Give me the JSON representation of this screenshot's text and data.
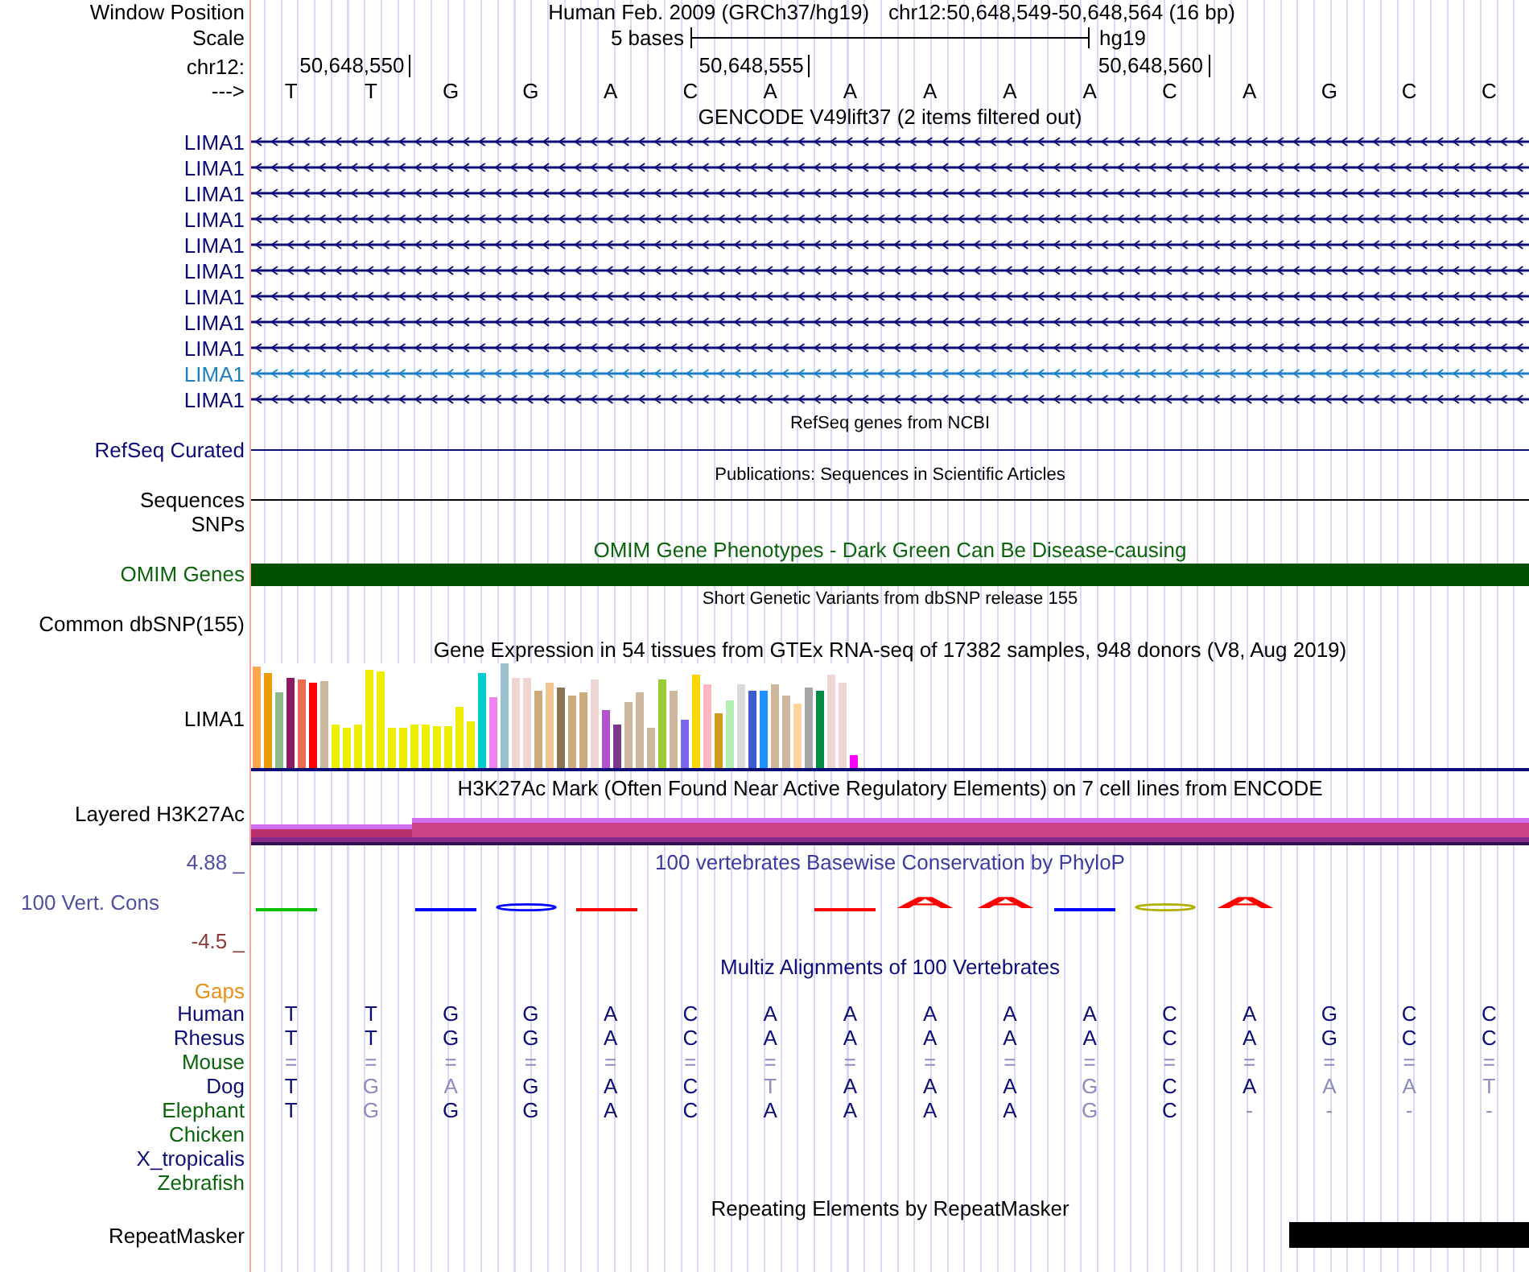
{
  "position": {
    "label": "Window Position",
    "assembly": "Human Feb. 2009 (GRCh37/hg19)",
    "range": "chr12:50,648,549-50,648,564 (16 bp)"
  },
  "scale": {
    "label": "Scale",
    "span": "5 bases",
    "assembly": "hg19"
  },
  "ruler": {
    "label": "chr12:",
    "ticks": [
      "50,648,550",
      "50,648,555",
      "50,648,560"
    ]
  },
  "sequence": {
    "label": "--->",
    "bases": [
      "T",
      "T",
      "G",
      "G",
      "A",
      "C",
      "A",
      "A",
      "A",
      "A",
      "A",
      "C",
      "A",
      "G",
      "C",
      "C"
    ]
  },
  "gencode": {
    "title": "GENCODE V49lift37 (2 items filtered out)",
    "transcripts": [
      {
        "name": "LIMA1",
        "color": "#0c0c78"
      },
      {
        "name": "LIMA1",
        "color": "#0c0c78"
      },
      {
        "name": "LIMA1",
        "color": "#0c0c78"
      },
      {
        "name": "LIMA1",
        "color": "#0c0c78"
      },
      {
        "name": "LIMA1",
        "color": "#0c0c78"
      },
      {
        "name": "LIMA1",
        "color": "#0c0c78"
      },
      {
        "name": "LIMA1",
        "color": "#0c0c78"
      },
      {
        "name": "LIMA1",
        "color": "#0c0c78"
      },
      {
        "name": "LIMA1",
        "color": "#0c0c78"
      },
      {
        "name": "LIMA1",
        "color": "#1f7fc4"
      },
      {
        "name": "LIMA1",
        "color": "#0c0c78"
      }
    ]
  },
  "refseq": {
    "title": "RefSeq genes from NCBI",
    "label": "RefSeq Curated"
  },
  "publications": {
    "title": "Publications: Sequences in Scientific Articles",
    "label": "Sequences"
  },
  "snps": {
    "label": "SNPs"
  },
  "omim": {
    "title": "OMIM Gene Phenotypes - Dark Green Can Be Disease-causing",
    "label": "OMIM Genes"
  },
  "dbsnp": {
    "title": "Short Genetic Variants from dbSNP release 155",
    "label": "Common dbSNP(155)"
  },
  "gtex": {
    "title": "Gene Expression in 54 tissues from GTEx RNA-seq of 17382 samples, 948 donors (V8, Aug 2019)",
    "label": "LIMA1",
    "bars": [
      {
        "color": "#ffa54f"
      },
      {
        "color": "#ee9a00"
      },
      {
        "color": "#8fbc8f"
      },
      {
        "color": "#8b1c62"
      },
      {
        "color": "#ee6a50"
      },
      {
        "color": "#ff0000"
      },
      {
        "color": "#cdb79e"
      },
      {
        "color": "#eeee00"
      },
      {
        "color": "#eeee00"
      },
      {
        "color": "#eeee00"
      },
      {
        "color": "#eeee00"
      },
      {
        "color": "#eeee00"
      },
      {
        "color": "#eeee00"
      },
      {
        "color": "#eeee00"
      },
      {
        "color": "#eeee00"
      },
      {
        "color": "#eeee00"
      },
      {
        "color": "#eeee00"
      },
      {
        "color": "#eeee00"
      },
      {
        "color": "#eeee00"
      },
      {
        "color": "#eeee00"
      },
      {
        "color": "#00cdcd"
      },
      {
        "color": "#ee82ee"
      },
      {
        "color": "#9ac0cd"
      },
      {
        "color": "#eed5d2"
      },
      {
        "color": "#eed5d2"
      },
      {
        "color": "#cdaa7d"
      },
      {
        "color": "#eec591"
      },
      {
        "color": "#8b7355"
      },
      {
        "color": "#cdaa7d"
      },
      {
        "color": "#cdaa7d"
      },
      {
        "color": "#eed5d2"
      },
      {
        "color": "#b452cd"
      },
      {
        "color": "#7a378b"
      },
      {
        "color": "#cdb79e"
      },
      {
        "color": "#cdb79e"
      },
      {
        "color": "#cdb79e"
      },
      {
        "color": "#9acd32"
      },
      {
        "color": "#cdb79e"
      },
      {
        "color": "#7a67ee"
      },
      {
        "color": "#ffd700"
      },
      {
        "color": "#ffb6c1"
      },
      {
        "color": "#cd9b1d"
      },
      {
        "color": "#b4eeb4"
      },
      {
        "color": "#d9d9d9"
      },
      {
        "color": "#3a5fcd"
      },
      {
        "color": "#1e90ff"
      },
      {
        "color": "#cdb79e"
      },
      {
        "color": "#cdb79e"
      },
      {
        "color": "#ffd39b"
      },
      {
        "color": "#a6a6a6"
      },
      {
        "color": "#008b45"
      },
      {
        "color": "#eed5d2"
      },
      {
        "color": "#eed5d2"
      },
      {
        "color": "#ff00ff"
      }
    ]
  },
  "h3k27ac": {
    "title": "H3K27Ac Mark (Often Found Near Active Regulatory Elements) on 7 cell lines from ENCODE",
    "label": "Layered H3K27Ac"
  },
  "phylop": {
    "title": "100 vertebrates Basewise Conservation by PhyloP",
    "label": "100 Vert. Cons",
    "max": "4.88 _",
    "min": "-4.5 _",
    "marks": [
      {
        "kind": "dash",
        "color": "#00c000"
      },
      {
        "kind": "blank"
      },
      {
        "kind": "dash",
        "color": "#0000ff"
      },
      {
        "kind": "ring",
        "color": "#0000ff"
      },
      {
        "kind": "dash",
        "color": "#ff0000"
      },
      {
        "kind": "blank"
      },
      {
        "kind": "blank"
      },
      {
        "kind": "dash",
        "color": "#ff0000"
      },
      {
        "kind": "letter",
        "text": "A",
        "color": "#ff0000"
      },
      {
        "kind": "letter",
        "text": "A",
        "color": "#ff0000"
      },
      {
        "kind": "dash",
        "color": "#0000ff"
      },
      {
        "kind": "ring",
        "color": "#b0b000"
      },
      {
        "kind": "letter",
        "text": "A",
        "color": "#ff0000"
      },
      {
        "kind": "blank"
      },
      {
        "kind": "blank"
      },
      {
        "kind": "blank"
      }
    ]
  },
  "multiz": {
    "title": "Multiz Alignments of 100 Vertebrates",
    "gaps_label": "Gaps",
    "species": [
      {
        "name": "Human",
        "color": "#0c0c78",
        "bases": [
          {
            "base": "T",
            "matches": true
          },
          {
            "base": "T",
            "matches": true
          },
          {
            "base": "G",
            "matches": true
          },
          {
            "base": "G",
            "matches": true
          },
          {
            "base": "A",
            "matches": true
          },
          {
            "base": "C",
            "matches": true
          },
          {
            "base": "A",
            "matches": true
          },
          {
            "base": "A",
            "matches": true
          },
          {
            "base": "A",
            "matches": true
          },
          {
            "base": "A",
            "matches": true
          },
          {
            "base": "A",
            "matches": true
          },
          {
            "base": "C",
            "matches": true
          },
          {
            "base": "A",
            "matches": true
          },
          {
            "base": "G",
            "matches": true
          },
          {
            "base": "C",
            "matches": true
          },
          {
            "base": "C",
            "matches": true
          }
        ]
      },
      {
        "name": "Rhesus",
        "color": "#0c0c78",
        "bases": [
          {
            "base": "T",
            "matches": true
          },
          {
            "base": "T",
            "matches": true
          },
          {
            "base": "G",
            "matches": true
          },
          {
            "base": "G",
            "matches": true
          },
          {
            "base": "A",
            "matches": true
          },
          {
            "base": "C",
            "matches": true
          },
          {
            "base": "A",
            "matches": true
          },
          {
            "base": "A",
            "matches": true
          },
          {
            "base": "A",
            "matches": true
          },
          {
            "base": "A",
            "matches": true
          },
          {
            "base": "A",
            "matches": true
          },
          {
            "base": "C",
            "matches": true
          },
          {
            "base": "A",
            "matches": true
          },
          {
            "base": "G",
            "matches": true
          },
          {
            "base": "C",
            "matches": true
          },
          {
            "base": "C",
            "matches": true
          }
        ]
      },
      {
        "name": "Mouse",
        "color": "#0c640c",
        "bases": [
          {
            "base": "=",
            "matches": false
          },
          {
            "base": "=",
            "matches": false
          },
          {
            "base": "=",
            "matches": false
          },
          {
            "base": "=",
            "matches": false
          },
          {
            "base": "=",
            "matches": false
          },
          {
            "base": "=",
            "matches": false
          },
          {
            "base": "=",
            "matches": false
          },
          {
            "base": "=",
            "matches": false
          },
          {
            "base": "=",
            "matches": false
          },
          {
            "base": "=",
            "matches": false
          },
          {
            "base": "=",
            "matches": false
          },
          {
            "base": "=",
            "matches": false
          },
          {
            "base": "=",
            "matches": false
          },
          {
            "base": "=",
            "matches": false
          },
          {
            "base": "=",
            "matches": false
          },
          {
            "base": "=",
            "matches": false
          }
        ]
      },
      {
        "name": "Dog",
        "color": "#0c0c78",
        "bases": [
          {
            "base": "T",
            "matches": true
          },
          {
            "base": "G",
            "matches": false
          },
          {
            "base": "A",
            "matches": false
          },
          {
            "base": "G",
            "matches": true
          },
          {
            "base": "A",
            "matches": true
          },
          {
            "base": "C",
            "matches": true
          },
          {
            "base": "T",
            "matches": false
          },
          {
            "base": "A",
            "matches": true
          },
          {
            "base": "A",
            "matches": true
          },
          {
            "base": "A",
            "matches": true
          },
          {
            "base": "G",
            "matches": false
          },
          {
            "base": "C",
            "matches": true
          },
          {
            "base": "A",
            "matches": true
          },
          {
            "base": "A",
            "matches": false
          },
          {
            "base": "A",
            "matches": false
          },
          {
            "base": "T",
            "matches": false
          }
        ]
      },
      {
        "name": "Elephant",
        "color": "#0c640c",
        "bases": [
          {
            "base": "T",
            "matches": true
          },
          {
            "base": "G",
            "matches": false
          },
          {
            "base": "G",
            "matches": true
          },
          {
            "base": "G",
            "matches": true
          },
          {
            "base": "A",
            "matches": true
          },
          {
            "base": "C",
            "matches": true
          },
          {
            "base": "A",
            "matches": true
          },
          {
            "base": "A",
            "matches": true
          },
          {
            "base": "A",
            "matches": true
          },
          {
            "base": "A",
            "matches": true
          },
          {
            "base": "G",
            "matches": false
          },
          {
            "base": "C",
            "matches": true
          },
          {
            "base": "-",
            "matches": false
          },
          {
            "base": "-",
            "matches": false
          },
          {
            "base": "-",
            "matches": false
          },
          {
            "base": "-",
            "matches": false
          }
        ]
      },
      {
        "name": "Chicken",
        "color": "#0c640c"
      },
      {
        "name": "X_tropicalis",
        "color": "#0c0c78"
      },
      {
        "name": "Zebrafish",
        "color": "#0c640c"
      }
    ]
  },
  "repeatmasker": {
    "title": "Repeating Elements by RepeatMasker",
    "label": "RepeatMasker"
  }
}
